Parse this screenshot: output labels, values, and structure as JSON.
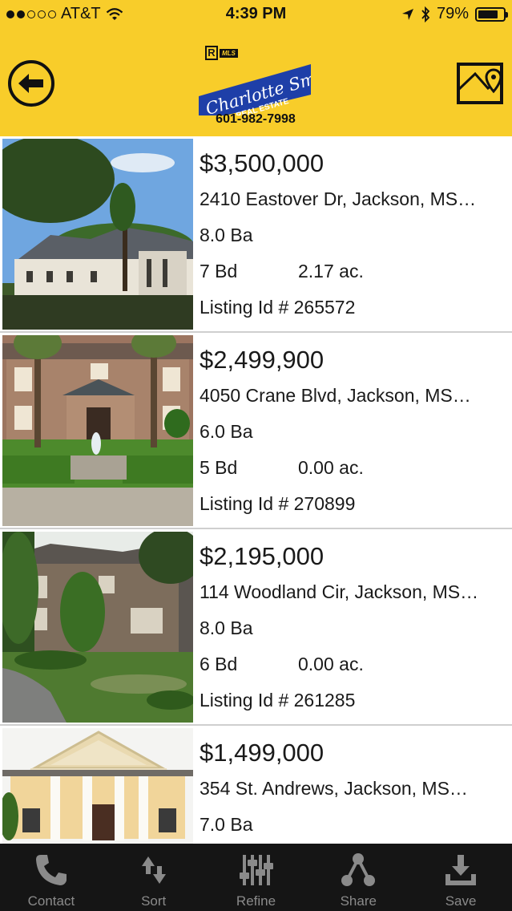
{
  "status_bar": {
    "carrier": "AT&T",
    "time": "4:39 PM",
    "battery": "79%",
    "battery_level": 0.79,
    "signal_bars_filled": 2,
    "signal_bars_total": 5
  },
  "header": {
    "logo": {
      "mls_mark": "MLS",
      "brand_script": "Charlotte Smith",
      "brand_sub": "REAL ESTATE",
      "phone": "601-982-7998"
    },
    "back_icon": "arrow-left-icon",
    "map_icon": "map-pin-icon"
  },
  "listings": [
    {
      "price": "$3,500,000",
      "address": "2410 Eastover Dr, Jackson, MS…",
      "baths": "8.0 Ba",
      "beds": "7 Bd",
      "acres": "2.17 ac.",
      "listing_id": "Listing Id # 265572"
    },
    {
      "price": "$2,499,900",
      "address": "4050 Crane Blvd, Jackson, MS…",
      "baths": "6.0 Ba",
      "beds": "5 Bd",
      "acres": "0.00 ac.",
      "listing_id": "Listing Id # 270899"
    },
    {
      "price": "$2,195,000",
      "address": "114 Woodland Cir, Jackson, MS…",
      "baths": "8.0 Ba",
      "beds": "6 Bd",
      "acres": "0.00 ac.",
      "listing_id": "Listing Id # 261285"
    },
    {
      "price": "$1,499,000",
      "address": "354 St. Andrews, Jackson, MS…",
      "baths": "7.0 Ba",
      "beds": "",
      "acres": "",
      "listing_id": ""
    }
  ],
  "tabbar": {
    "items": [
      {
        "label": "Contact",
        "icon": "phone-icon"
      },
      {
        "label": "Sort",
        "icon": "sort-arrows-icon"
      },
      {
        "label": "Refine",
        "icon": "sliders-icon"
      },
      {
        "label": "Share",
        "icon": "share-icon"
      },
      {
        "label": "Save",
        "icon": "download-icon"
      }
    ]
  },
  "colors": {
    "header_yellow": "#f8cd2a",
    "logo_blue": "#1e3fa8",
    "tabbar_bg": "#151515",
    "tab_icon": "#8a8a8a"
  }
}
